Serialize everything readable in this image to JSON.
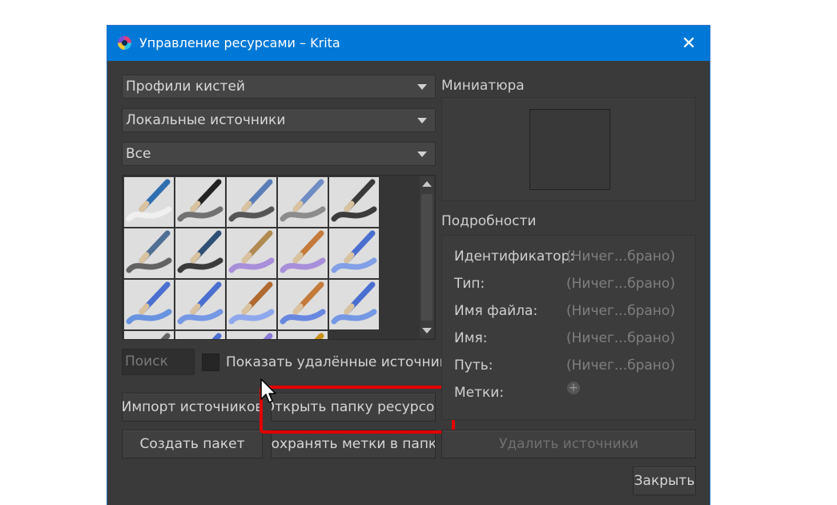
{
  "window": {
    "title": "Управление ресурсами – Krita",
    "close_symbol": "✕"
  },
  "filters": {
    "resource_type": "Профили кистей",
    "storage": "Локальные источники",
    "tag": "Все"
  },
  "resources": {
    "thumbnails": [
      "eraser-brush",
      "ink-pen-brush",
      "pencil-brush",
      "pencil-light-brush",
      "fountain-pen-brush",
      "marker-brush",
      "marker-dark-brush",
      "palette-knife-brush",
      "watercolor-brush",
      "blue-brush",
      "blue-wet-brush",
      "blue-soft-brush",
      "blue-broad-brush",
      "blue-fan-brush",
      "blue-flat-brush",
      "gray-brush",
      "blue-stroke-brush",
      "lavender-brush",
      "gold-brush",
      "empty"
    ]
  },
  "search": {
    "placeholder": "Поиск"
  },
  "show_deleted": {
    "label": "Показать удалённые источники"
  },
  "buttons": {
    "import": "Импорт источников",
    "open_folder": "Открыть папку ресурсов",
    "create_bundle": "Создать пакет",
    "save_tags": "Сохранять метки в папку",
    "delete": "Удалить источники",
    "close": "Закрыть"
  },
  "preview": {
    "label": "Миниатюра"
  },
  "details": {
    "label": "Подробности",
    "rows": [
      {
        "key": "Идентификатор:",
        "value": "(Ничег...брано)"
      },
      {
        "key": "Тип:",
        "value": "(Ничег...брано)"
      },
      {
        "key": "Имя файла:",
        "value": "(Ничег...брано)"
      },
      {
        "key": "Имя:",
        "value": "(Ничег...брано)"
      },
      {
        "key": "Путь:",
        "value": "(Ничег...брано)"
      }
    ],
    "tags_label": "Метки:",
    "add_tag_symbol": "+"
  },
  "colors": {
    "titlebar": "#0078d7",
    "window_bg": "#3a3a3a",
    "highlight": "#e10000"
  }
}
